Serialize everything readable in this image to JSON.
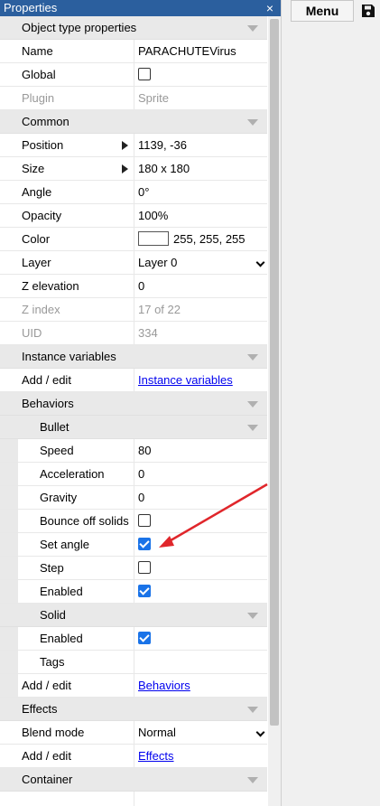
{
  "panel": {
    "title": "Properties",
    "close_glyph": "×"
  },
  "toolbar": {
    "menu_label": "Menu",
    "save_icon": "floppy-disk-icon"
  },
  "sections": {
    "object_type": "Object type properties",
    "common": "Common",
    "instance_variables": "Instance variables",
    "behaviors": "Behaviors",
    "bullet": "Bullet",
    "solid": "Solid",
    "effects": "Effects",
    "container": "Container"
  },
  "props": {
    "name": {
      "label": "Name",
      "value": "PARACHUTEVirus"
    },
    "global": {
      "label": "Global",
      "checked": false
    },
    "plugin": {
      "label": "Plugin",
      "value": "Sprite"
    },
    "position": {
      "label": "Position",
      "value": "1139, -36"
    },
    "size": {
      "label": "Size",
      "value": "180 x 180"
    },
    "angle": {
      "label": "Angle",
      "value": "0°"
    },
    "opacity": {
      "label": "Opacity",
      "value": "100%"
    },
    "color": {
      "label": "Color",
      "value": "255, 255, 255",
      "swatch": "#ffffff"
    },
    "layer": {
      "label": "Layer",
      "value": "Layer 0"
    },
    "z_elevation": {
      "label": "Z elevation",
      "value": "0"
    },
    "z_index": {
      "label": "Z index",
      "value": "17 of 22"
    },
    "uid": {
      "label": "UID",
      "value": "334"
    },
    "iv_add_edit": {
      "label": "Add / edit",
      "value": "Instance variables"
    },
    "speed": {
      "label": "Speed",
      "value": "80"
    },
    "acceleration": {
      "label": "Acceleration",
      "value": "0"
    },
    "gravity": {
      "label": "Gravity",
      "value": "0"
    },
    "bounce": {
      "label": "Bounce off solids",
      "checked": false
    },
    "set_angle": {
      "label": "Set angle",
      "checked": true
    },
    "step": {
      "label": "Step",
      "checked": false
    },
    "bullet_enabled": {
      "label": "Enabled",
      "checked": true
    },
    "solid_enabled": {
      "label": "Enabled",
      "checked": true
    },
    "tags": {
      "label": "Tags",
      "value": ""
    },
    "beh_add_edit": {
      "label": "Add / edit",
      "value": "Behaviors"
    },
    "blend_mode": {
      "label": "Blend mode",
      "value": "Normal"
    },
    "fx_add_edit": {
      "label": "Add / edit",
      "value": "Effects"
    }
  },
  "colors": {
    "titlebar": "#2b5f9e",
    "checkbox_checked": "#1a73e8",
    "annotation_arrow": "#e0262b",
    "link": "#0000ee"
  }
}
